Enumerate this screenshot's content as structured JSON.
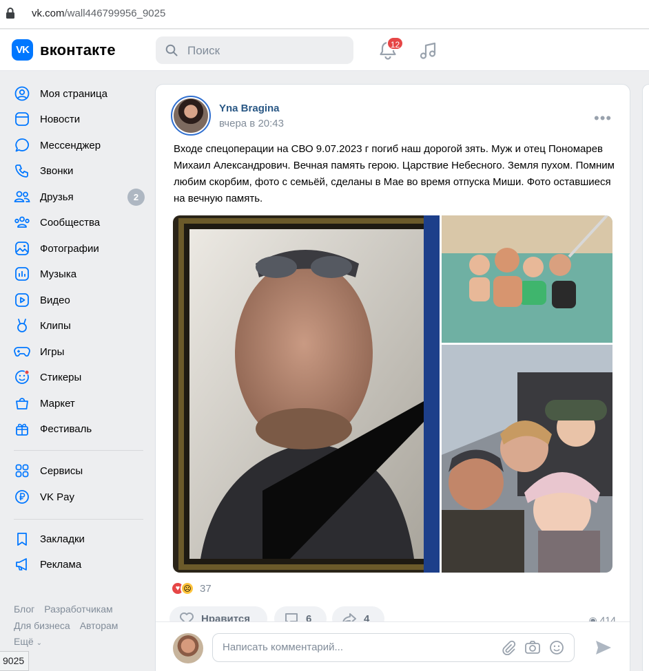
{
  "browser": {
    "url_host": "vk.com",
    "url_path": "/wall446799956_9025",
    "status_url": "9025"
  },
  "header": {
    "logo_badge": "VK",
    "logo_text": "вконтакте",
    "search_placeholder": "Поиск",
    "notifications_count": "12"
  },
  "sidebar": {
    "items": [
      {
        "label": "Моя страница",
        "icon": "user-circle-icon"
      },
      {
        "label": "Новости",
        "icon": "news-icon"
      },
      {
        "label": "Мессенджер",
        "icon": "message-icon"
      },
      {
        "label": "Звонки",
        "icon": "phone-icon"
      },
      {
        "label": "Друзья",
        "icon": "friends-icon",
        "badge": "2"
      },
      {
        "label": "Сообщества",
        "icon": "communities-icon"
      },
      {
        "label": "Фотографии",
        "icon": "photos-icon"
      },
      {
        "label": "Музыка",
        "icon": "music-icon"
      },
      {
        "label": "Видео",
        "icon": "video-icon"
      },
      {
        "label": "Клипы",
        "icon": "clips-icon"
      },
      {
        "label": "Игры",
        "icon": "games-icon"
      },
      {
        "label": "Стикеры",
        "icon": "stickers-icon"
      },
      {
        "label": "Маркет",
        "icon": "market-icon"
      },
      {
        "label": "Фестиваль",
        "icon": "festival-icon"
      }
    ],
    "items2": [
      {
        "label": "Сервисы",
        "icon": "services-icon"
      },
      {
        "label": "VK Pay",
        "icon": "vkpay-icon"
      }
    ],
    "items3": [
      {
        "label": "Закладки",
        "icon": "bookmark-icon"
      },
      {
        "label": "Реклама",
        "icon": "ads-icon"
      }
    ],
    "footer": {
      "blog": "Блог",
      "dev": "Разработчикам",
      "business": "Для бизнеса",
      "authors": "Авторам",
      "more": "Ещё"
    }
  },
  "post": {
    "author": "Yna Bragina",
    "time": "вчера в 20:43",
    "text": "Входе спецоперации на СВО 9.07.2023 г погиб наш дорогой зять. Муж и отец Пономарев Михаил Александрович. Вечная память герою. Царствие Небесного. Земля пухом. Помним любим скорбим, фото с семьёй, сделаны в Мае во время отпуска Миши. Фото оставшиеся на вечную память.",
    "reactions_count": "37",
    "like_label": "Нравится",
    "comments_count": "6",
    "shares_count": "4",
    "views_count": "414"
  },
  "comment": {
    "placeholder": "Написать комментарий..."
  },
  "colors": {
    "accent": "#0077ff",
    "link": "#2a5885",
    "badge_red": "#e64646"
  }
}
